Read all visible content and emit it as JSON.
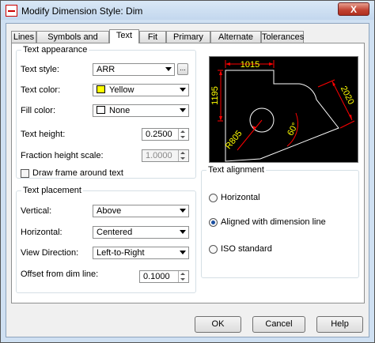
{
  "window": {
    "title": "Modify Dimension Style: Dim",
    "close_label": "X"
  },
  "tabs": [
    {
      "label": "Lines"
    },
    {
      "label": "Symbols and Arrows"
    },
    {
      "label": "Text"
    },
    {
      "label": "Fit"
    },
    {
      "label": "Primary Units"
    },
    {
      "label": "Alternate Units"
    },
    {
      "label": "Tolerances"
    }
  ],
  "active_tab": "Text",
  "text_appearance": {
    "title": "Text appearance",
    "text_style": {
      "label": "Text style:",
      "value": "ARR",
      "browse_label": "..."
    },
    "text_color": {
      "label": "Text color:",
      "value": "Yellow",
      "swatch": "#ffff00"
    },
    "fill_color": {
      "label": "Fill color:",
      "value": "None",
      "swatch": "#ffffff"
    },
    "text_height": {
      "label": "Text height:",
      "value": "0.2500"
    },
    "fraction_height_scale": {
      "label": "Fraction height scale:",
      "value": "1.0000"
    },
    "draw_frame": {
      "label": "Draw frame around text",
      "checked": false
    }
  },
  "text_placement": {
    "title": "Text placement",
    "vertical": {
      "label": "Vertical:",
      "value": "Above"
    },
    "horizontal": {
      "label": "Horizontal:",
      "value": "Centered"
    },
    "view_direction": {
      "label": "View Direction:",
      "value": "Left-to-Right"
    },
    "offset": {
      "label": "Offset from dim line:",
      "value": "0.1000"
    }
  },
  "text_alignment": {
    "title": "Text alignment",
    "options": [
      {
        "label": "Horizontal",
        "selected": false
      },
      {
        "label": "Aligned with dimension line",
        "selected": true
      },
      {
        "label": "ISO standard",
        "selected": false
      }
    ]
  },
  "preview": {
    "dim_top": "1015",
    "dim_left": "1195",
    "dim_right": "2020",
    "dim_angle": "60°",
    "dim_radius": "R805",
    "colors": {
      "background": "#000000",
      "geometry": "#ffffff",
      "dimension": "#ff0000",
      "text": "#ffff00",
      "dim_text": "#00ff00"
    }
  },
  "buttons": {
    "ok": "OK",
    "cancel": "Cancel",
    "help": "Help"
  }
}
